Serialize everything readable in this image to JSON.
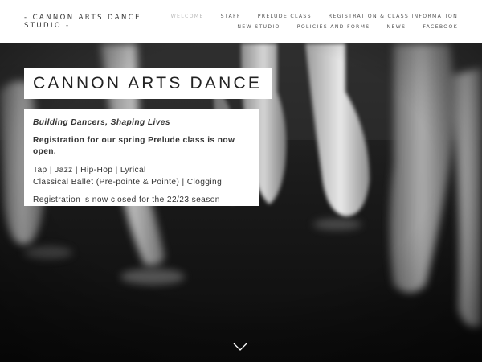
{
  "site": {
    "logo_text": "- CANNON ARTS DANCE STUDIO -"
  },
  "nav": {
    "row1": [
      {
        "label": "WELCOME",
        "active": true
      },
      {
        "label": "STAFF",
        "active": false
      },
      {
        "label": "PRELUDE CLASS",
        "active": false
      },
      {
        "label": "REGISTRATION & CLASS INFORMATION",
        "active": false
      }
    ],
    "row2": [
      {
        "label": "NEW STUDIO",
        "active": false
      },
      {
        "label": "POLICIES AND FORMS",
        "active": false
      },
      {
        "label": "NEWS",
        "active": false
      },
      {
        "label": "FACEBOOK",
        "active": false
      }
    ]
  },
  "hero": {
    "title": "CANNON ARTS DANCE",
    "tagline": "Building Dancers, Shaping Lives",
    "registration_open": "Registration for our spring Prelude class is now open.",
    "styles_line1": "Tap | Jazz | Hip-Hop | Lyrical",
    "styles_line2": "Classical Ballet (Pre-pointe & Pointe) | Clogging",
    "registration_closed": "Registration is now closed for the 22/23 season",
    "background_icon": "ballet-pointe-shoes-photo",
    "scroll_icon": "chevron-down-icon"
  },
  "colors": {
    "header_bg": "#ffffff",
    "text_dark": "#333333",
    "nav_active": "#b8b8b8",
    "hero_dark": "#1d1d1d"
  }
}
